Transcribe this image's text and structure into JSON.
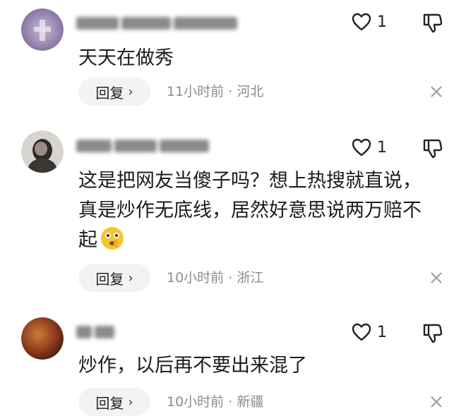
{
  "comments": [
    {
      "username_hidden": true,
      "text": "天天在做秀",
      "likes": "1",
      "reply_label": "回复",
      "time": "11小时前",
      "sep": "·",
      "location": "河北"
    },
    {
      "username_hidden": true,
      "text": "这是把网友当傻子吗？想上热搜就直说，真是炒作无底线，居然好意思说两万赔不起",
      "likes": "1",
      "reply_label": "回复",
      "time": "10小时前",
      "sep": "·",
      "location": "浙江"
    },
    {
      "username_hidden": true,
      "text": "炒作，以后再不要出来混了",
      "likes": "1",
      "reply_label": "回复",
      "time": "10小时前",
      "sep": "·",
      "location": "新疆"
    }
  ],
  "icons": {
    "like": "heart-outline-icon",
    "dislike": "thumbs-down-icon",
    "close": "close-icon",
    "reply_chevron": "chevron-right-icon",
    "emoji": "shush-emoji"
  },
  "colors": {
    "reply_bg": "#f3f3f3",
    "meta_text": "#8c8c8c"
  }
}
